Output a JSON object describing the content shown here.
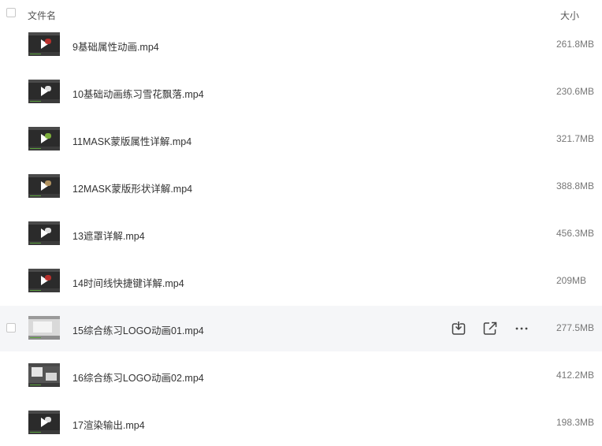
{
  "header": {
    "name_label": "文件名",
    "size_label": "大小"
  },
  "files": [
    {
      "name": "9基础属性动画.mp4",
      "size": "261.8MB",
      "thumb": "dark",
      "accent": "#d0312d"
    },
    {
      "name": "10基础动画练习雪花飘落.mp4",
      "size": "230.6MB",
      "thumb": "dark",
      "accent": "#ffffff"
    },
    {
      "name": "11MASK蒙版属性详解.mp4",
      "size": "321.7MB",
      "thumb": "dark",
      "accent": "#8cc63f"
    },
    {
      "name": "12MASK蒙版形状详解.mp4",
      "size": "388.8MB",
      "thumb": "dark",
      "accent": "#c9a46a"
    },
    {
      "name": "13遮罩详解.mp4",
      "size": "456.3MB",
      "thumb": "dark",
      "accent": "#ffffff"
    },
    {
      "name": "14时间线快捷键详解.mp4",
      "size": "209MB",
      "thumb": "dark",
      "accent": "#d0312d"
    },
    {
      "name": "15综合练习LOGO动画01.mp4",
      "size": "277.5MB",
      "thumb": "light",
      "accent": "#ffffff"
    },
    {
      "name": "16综合练习LOGO动画02.mp4",
      "size": "412.2MB",
      "thumb": "mixed",
      "accent": "#ffffff"
    },
    {
      "name": "17渲染输出.mp4",
      "size": "198.3MB",
      "thumb": "dark",
      "accent": "#ffffff"
    }
  ],
  "hover_row_index": 6,
  "hover_actions": [
    {
      "name": "download-icon",
      "label": "下载"
    },
    {
      "name": "share-icon",
      "label": "分享"
    },
    {
      "name": "more-icon",
      "label": "更多"
    }
  ],
  "colors": {
    "hover_bg": "#f5f6f8",
    "text": "#333333",
    "muted": "#777777"
  }
}
